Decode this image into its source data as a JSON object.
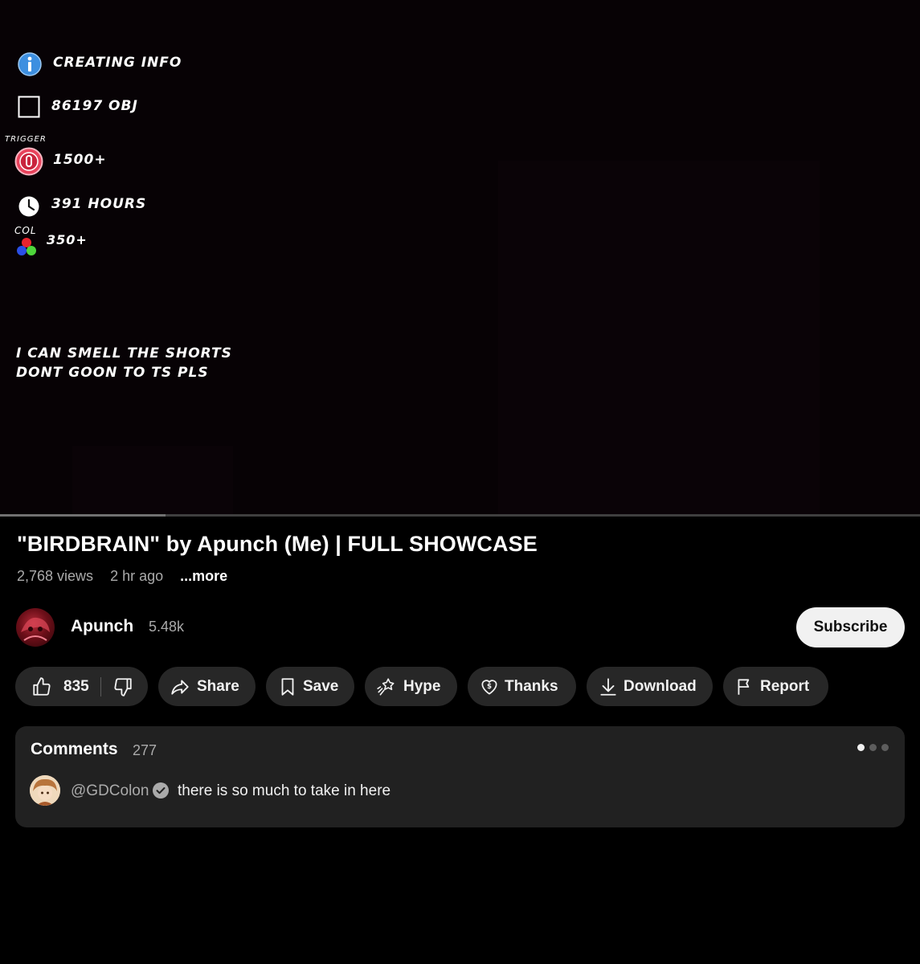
{
  "video": {
    "overlay": {
      "info_header": "CREATING INFO",
      "objects": "86197 OBJ",
      "trigger_label": "TRIGGER",
      "triggers": "1500+",
      "hours": "391 HOURS",
      "col_label": "COL",
      "colors": "350+",
      "note_line1": "I CAN SMELL THE SHORTS",
      "note_line2": "DONT GOON TO TS PLS"
    },
    "progress_fraction": 0.18
  },
  "title": "\"BIRDBRAIN\" by Apunch (Me) | FULL SHOWCASE",
  "meta": {
    "views": "2,768 views",
    "age": "2 hr ago",
    "more": "...more"
  },
  "channel": {
    "name": "Apunch",
    "subscribers": "5.48k",
    "subscribe_label": "Subscribe"
  },
  "actions": {
    "likes": "835",
    "share": "Share",
    "save": "Save",
    "hype": "Hype",
    "thanks": "Thanks",
    "download": "Download",
    "report": "Report"
  },
  "comments": {
    "title": "Comments",
    "count": "277",
    "top_comment": {
      "author": "@GDColon",
      "text": "there is so much to take in here"
    }
  },
  "colors": {
    "background": "#000000",
    "pill": "#272727",
    "panel": "#212121",
    "secondary_text": "#aaaaaa",
    "subscribe_bg": "#f1f1f1",
    "trigger_icon": "#e8435c",
    "info_icon": "#3d8fe0"
  }
}
